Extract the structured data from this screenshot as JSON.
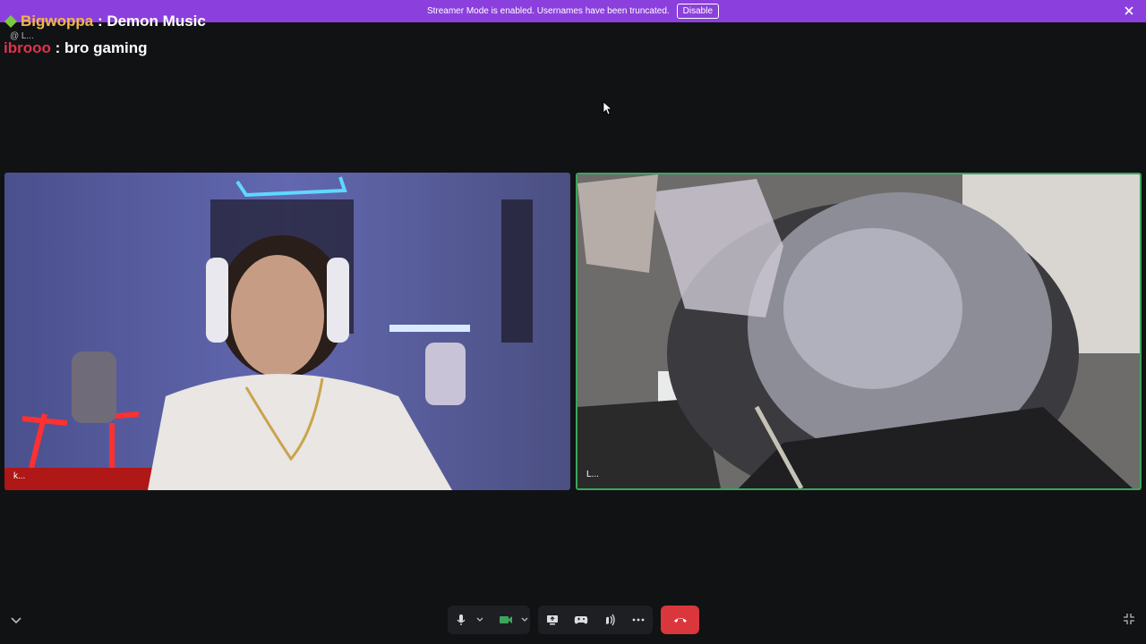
{
  "banner": {
    "text": "Streamer Mode is enabled. Usernames have been truncated.",
    "disable_label": "Disable"
  },
  "chat": [
    {
      "user": "Bigwoppa",
      "sep": " : ",
      "message": "Demon Music"
    },
    {
      "user": "ibrooo",
      "sep": " : ",
      "message": "bro gaming"
    }
  ],
  "chat_truncated": "@ L...",
  "participants": [
    {
      "label": "k..."
    },
    {
      "label": "L..."
    }
  ],
  "colors": {
    "banner": "#8b3fdc",
    "speaking_border": "#3ba55c",
    "end_call": "#da373c",
    "video_active": "#3ba55c"
  },
  "icons": [
    "close-icon",
    "gem-icon",
    "microphone-icon",
    "chevron-down-icon",
    "camera-icon",
    "screen-share-icon",
    "gamepad-icon",
    "soundboard-icon",
    "more-icon",
    "hang-up-icon",
    "minimize-icon"
  ]
}
